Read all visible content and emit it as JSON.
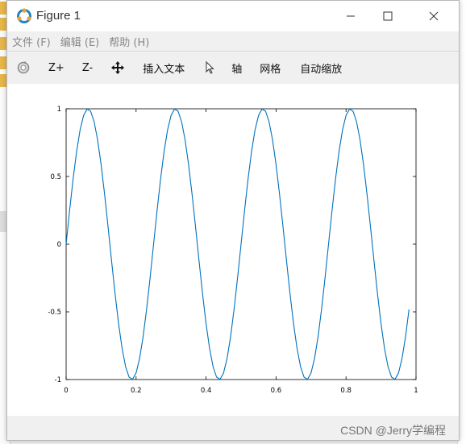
{
  "window": {
    "title": "Figure 1",
    "menus": [
      "文件 (F)",
      "编辑 (E)",
      "帮助 (H)"
    ],
    "toolbar": {
      "zoom_in": "Z+",
      "zoom_out": "Z-",
      "insert_text": "插入文本",
      "axes": "轴",
      "grid": "网格",
      "autoscale": "自动缩放"
    },
    "watermark": "CSDN @Jerry学编程"
  },
  "colors": {
    "line": "#0072bd",
    "menu_text": "#888888"
  },
  "chart_data": {
    "type": "line",
    "function": "sin(2*pi*4*t)",
    "x_range": [
      0,
      0.98
    ],
    "x_step": 0.01,
    "xlim": [
      0,
      1
    ],
    "ylim": [
      -1,
      1
    ],
    "xticks": [
      "0",
      "0.2",
      "0.4",
      "0.6",
      "0.8",
      "1"
    ],
    "yticks": [
      "1",
      "0.5",
      "0",
      "-0.5",
      "-1"
    ],
    "grid": false,
    "title": "",
    "xlabel": "",
    "ylabel": ""
  }
}
